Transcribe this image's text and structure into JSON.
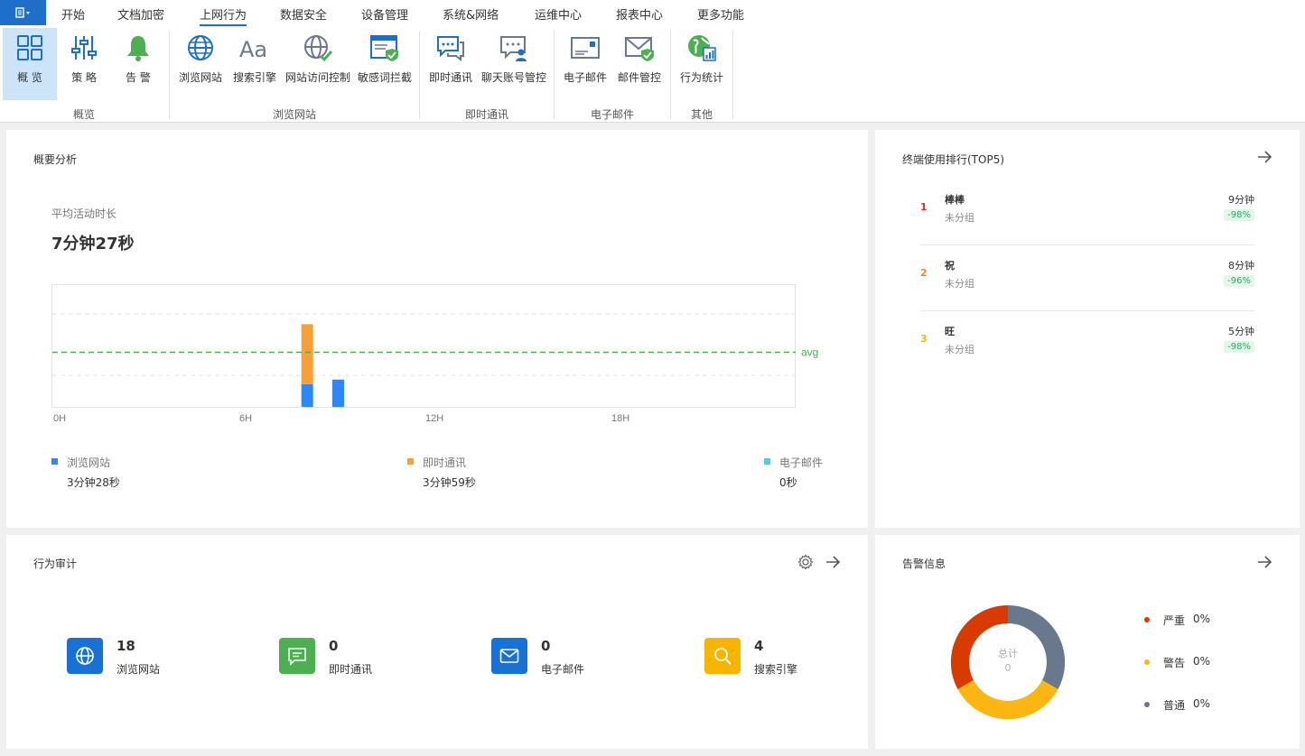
{
  "menu": {
    "items": [
      "开始",
      "文档加密",
      "上网行为",
      "数据安全",
      "设备管理",
      "系统&网络",
      "运维中心",
      "报表中心",
      "更多功能"
    ],
    "active": "上网行为"
  },
  "ribbon": {
    "buttons": [
      "概 览",
      "策 略",
      "告 警",
      "浏览网站",
      "搜索引擎",
      "网站访问控制",
      "敏感词拦截",
      "即时通讯",
      "聊天账号管控",
      "电子邮件",
      "邮件管控",
      "行为统计"
    ],
    "groups": [
      "概览",
      "浏览网站",
      "即时通讯",
      "电子邮件",
      "其他"
    ]
  },
  "overview": {
    "title": "概要分析",
    "avg_label": "平均活动时长",
    "avg_value": "7分钟27秒",
    "avg_line_label": "avg",
    "legend": [
      {
        "name": "浏览网站",
        "value": "3分钟28秒",
        "color": "#2f86f6"
      },
      {
        "name": "即时通讯",
        "value": "3分钟59秒",
        "color": "#f5a13a"
      },
      {
        "name": "电子邮件",
        "value": "0秒",
        "color": "#62c6de"
      }
    ]
  },
  "chart_data": {
    "type": "bar",
    "stacked": true,
    "x_tick_labels": [
      "0H",
      "6H",
      "12H",
      "18H"
    ],
    "x_range": [
      0,
      24
    ],
    "categories": [
      "8H",
      "9H"
    ],
    "series": [
      {
        "name": "浏览网站",
        "values": [
          25,
          30
        ],
        "color": "#2f86f6"
      },
      {
        "name": "即时通讯",
        "values": [
          66,
          0
        ],
        "color": "#f5a13a"
      },
      {
        "name": "电子邮件",
        "values": [
          0,
          0
        ],
        "color": "#62c6de"
      }
    ],
    "avg_line": 60,
    "ylim": [
      0,
      135
    ],
    "grid": "horizontal dashed",
    "y_unit": "",
    "legend": "bottom"
  },
  "ranking": {
    "title": "终端使用排行(TOP5)",
    "items": [
      {
        "rank": "1",
        "name": "棒棒",
        "group": "未分组",
        "time": "9分钟",
        "change": "-98%",
        "color": "#d9302c"
      },
      {
        "rank": "2",
        "name": "祝",
        "group": "未分组",
        "time": "8分钟",
        "change": "-96%",
        "color": "#ef8a24"
      },
      {
        "rank": "3",
        "name": "旺",
        "group": "未分组",
        "time": "5分钟",
        "change": "-98%",
        "color": "#f3b21c"
      }
    ]
  },
  "audit": {
    "title": "行为审计",
    "items": [
      {
        "count": "18",
        "label": "浏览网站",
        "icon": "globe-icon",
        "color": "#1872d6"
      },
      {
        "count": "0",
        "label": "即时通讯",
        "icon": "chat-icon",
        "color": "#4caf50"
      },
      {
        "count": "0",
        "label": "电子邮件",
        "icon": "mail-icon",
        "color": "#1872d6"
      },
      {
        "count": "4",
        "label": "搜索引擎",
        "icon": "search-icon",
        "color": "#f7b500"
      }
    ]
  },
  "alarm": {
    "title": "告警信息",
    "total_label": "总计",
    "total_value": "0",
    "items": [
      {
        "name": "严重",
        "percent": "0%",
        "color": "#d83b01"
      },
      {
        "name": "警告",
        "percent": "0%",
        "color": "#fbb611"
      },
      {
        "name": "普通",
        "percent": "0%",
        "color": "#69788c"
      }
    ]
  }
}
